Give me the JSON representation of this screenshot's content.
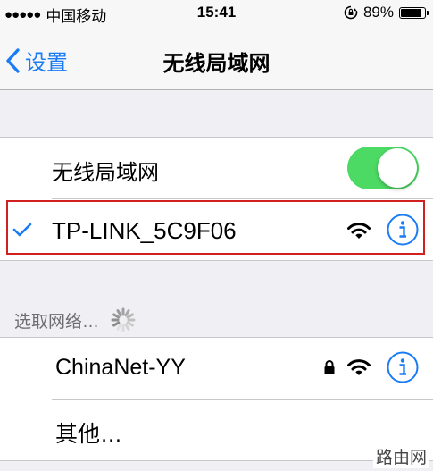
{
  "status_bar": {
    "signal": "●●●●●",
    "carrier": "中国移动",
    "time": "15:41",
    "battery_percent_text": "89%",
    "battery_level": 0.89
  },
  "nav": {
    "back_label": "设置",
    "title": "无线局域网"
  },
  "wifi_toggle": {
    "label": "无线局域网",
    "on": true
  },
  "connected_network": {
    "name": "TP-LINK_5C9F06",
    "secured": false,
    "check_icon": "checkmark-icon"
  },
  "choose_network": {
    "header": "选取网络…"
  },
  "networks": [
    {
      "name": "ChinaNet-YY",
      "secured": true
    }
  ],
  "other_label": "其他…",
  "watermark": "路由网",
  "colors": {
    "accent": "#1a7cf5",
    "toggle_on": "#4cd964",
    "highlight": "#d0201f"
  }
}
